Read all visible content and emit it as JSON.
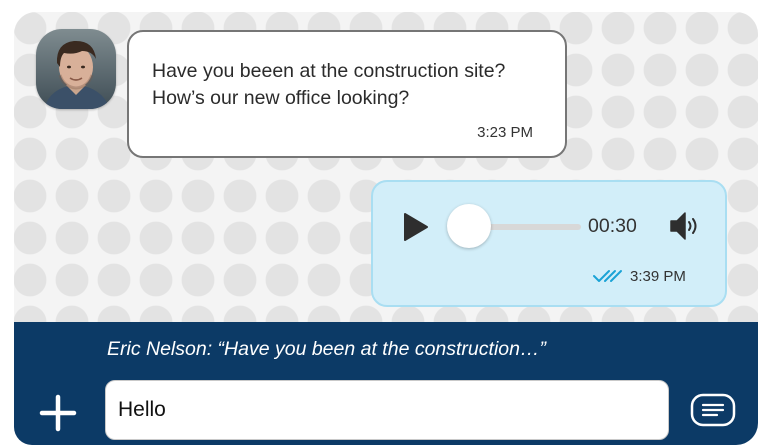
{
  "incoming_message": {
    "text": "Have you beeen at the construction site? How’s our new office looking?",
    "time": "3:23 PM"
  },
  "voice_message": {
    "duration": "00:30",
    "time": "3:39 PM",
    "progress": 0.0,
    "status": "read"
  },
  "composer": {
    "reply_preview": "Eric Nelson: “Have you been at the construction…”",
    "input_value": "Hello"
  },
  "icons": {
    "avatar": "avatar",
    "play": "play-icon",
    "volume": "volume-icon",
    "read": "double-check-icon",
    "add": "plus-icon",
    "send": "message-icon"
  },
  "colors": {
    "outgoing_bubble": "#d2eef9",
    "composer_bar": "#0c3a66",
    "read_check": "#1aa3d6"
  }
}
